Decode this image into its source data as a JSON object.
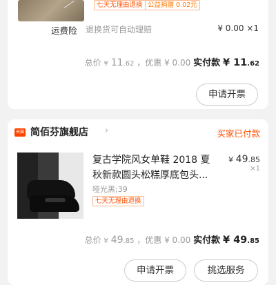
{
  "order1": {
    "tags": {
      "return7": "七天无理由退换",
      "charity": "公益捐赠 0.02元"
    },
    "shipping_insurance": {
      "label": "运费险",
      "desc": "退换货可自动理赔",
      "price": "¥ 0.00 ×1"
    },
    "total": {
      "label": "总价",
      "currency": "¥",
      "amount_int": "11",
      "amount_dec": ".62",
      "discount_label": "，优惠",
      "discount": "¥ 0.00",
      "paid_label": "实付款",
      "paid_int": "¥ 11",
      "paid_dec": ".62"
    },
    "buttons": {
      "invoice": "申请开票"
    }
  },
  "order2": {
    "shop": {
      "logo": "天猫",
      "name": "简佰芬旗舰店",
      "chevron": "›",
      "status": "买家已付款"
    },
    "item": {
      "title_line1": "复古学院风女单鞋 2018 夏",
      "title_line2": "秋新款圆头松糕厚底包头...",
      "price_symbol": "¥ ",
      "price_int": "49",
      "price_dec": ".85",
      "qty": "×1",
      "sku": "哑光黑;39",
      "tag_return": "七天无理由退换"
    },
    "total": {
      "label": "总价",
      "currency": "¥",
      "amount_int": "49",
      "amount_dec": ".85",
      "discount_label": "，优惠",
      "discount": "¥ 0.00",
      "paid_label": "实付款",
      "paid_int": "¥ 49",
      "paid_dec": ".85"
    },
    "buttons": {
      "invoice": "申请开票",
      "service": "挑选服务"
    }
  },
  "colors": {
    "accent": "#ff5000",
    "background": "#f2f2f2"
  },
  "icons": {
    "shop_logo": "tmall-logo-icon",
    "chevron": "chevron-right-icon"
  }
}
